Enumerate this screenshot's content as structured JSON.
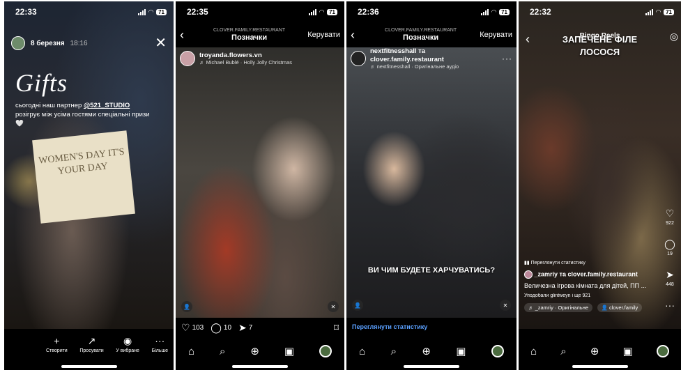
{
  "screen1": {
    "time": "22:33",
    "battery": "71",
    "date": "8 березня",
    "timestamp": "18:16",
    "close": "✕",
    "gifts_title": "Gifts",
    "story_text_pre": "сьогодні наш партнер ",
    "partner": "@521_STUDIO",
    "story_text_post": " розігрує між усіма гостями спеціальні призи 🤍",
    "card_text": "WOMEN'S DAY IT'S YOUR DAY",
    "actions": [
      {
        "icon": "+",
        "label": "Створити"
      },
      {
        "icon": "↗",
        "label": "Просувати"
      },
      {
        "icon": "◉",
        "label": "У вибране"
      },
      {
        "icon": "···",
        "label": "Більше"
      }
    ]
  },
  "screen2": {
    "time": "22:35",
    "battery": "71",
    "account_small": "CLOVER.FAMILY.RESTAURANT",
    "title": "Позначки",
    "manage": "Керувати",
    "username": "troyanda.flowers.vn",
    "audio": "♬ Michael Bublé · Holly Jolly Christmas",
    "likes": "103",
    "comments": "10",
    "shares": "7"
  },
  "screen3": {
    "time": "22:36",
    "battery": "71",
    "account_small": "CLOVER.FAMILY.RESTAURANT",
    "title": "Позначки",
    "manage": "Керувати",
    "username": "nextfitnesshall та clover.family.restaurant",
    "audio": "♬ nextfitnesshall · Оригінальне аудіо",
    "caption_overlay": "ВИ ЧИМ БУДЕТЕ ХАРЧУВАТИСЬ?",
    "stats_link": "Переглянути статистику"
  },
  "screen4": {
    "time": "22:32",
    "battery": "71",
    "header_small": "Bingo Reels",
    "title_line1": "ЗАПЕЧЕНЕ ФІЛЕ",
    "title_line2": "ЛОСОСЯ",
    "likes": "922",
    "comments": "19",
    "shares": "448",
    "stats": "Переглянути статистику",
    "user": "_zamriy та clover.family.restaurant",
    "desc": "Величезна ігрова кімната для дітей, ПП ...",
    "liked_by": "Уподобали glintweyn і ще 921",
    "audio_pill": "_zamriy · Оригінальне",
    "tag_pill": "clover.family"
  }
}
